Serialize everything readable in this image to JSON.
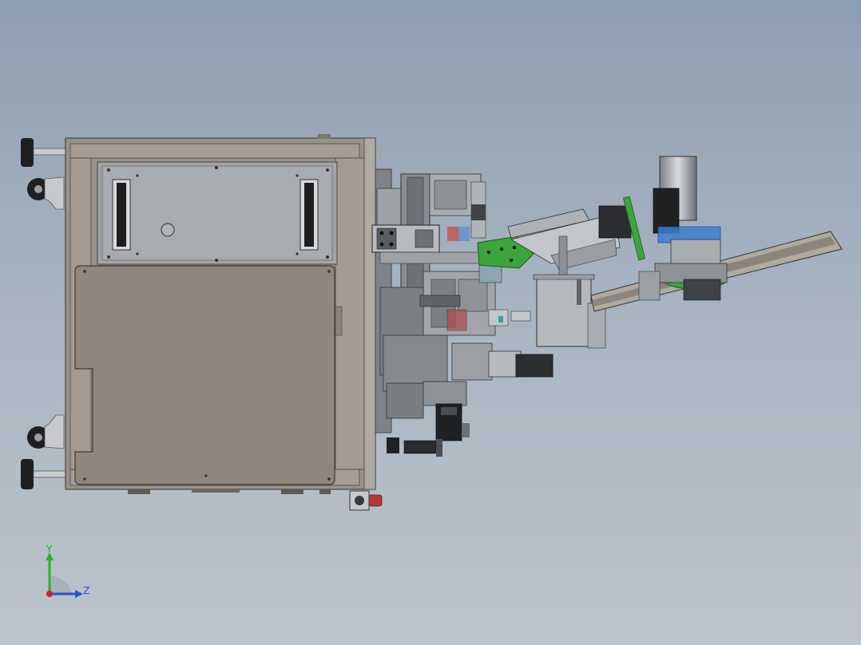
{
  "triad": {
    "y_label": "Y",
    "z_label": "Z"
  },
  "colors": {
    "background_top": "#8e9eb1",
    "background_bottom": "#bcc4cc",
    "cabinet_panel": "#8f877e",
    "cabinet_frame": "#9a928a",
    "upper_panel": "#a1a4a8",
    "machine_green": "#3aa53a",
    "machine_blue": "#3a7fd0",
    "axis_y": "#2bb02b",
    "axis_z": "#2a54d8",
    "axis_x": "#d42020"
  }
}
